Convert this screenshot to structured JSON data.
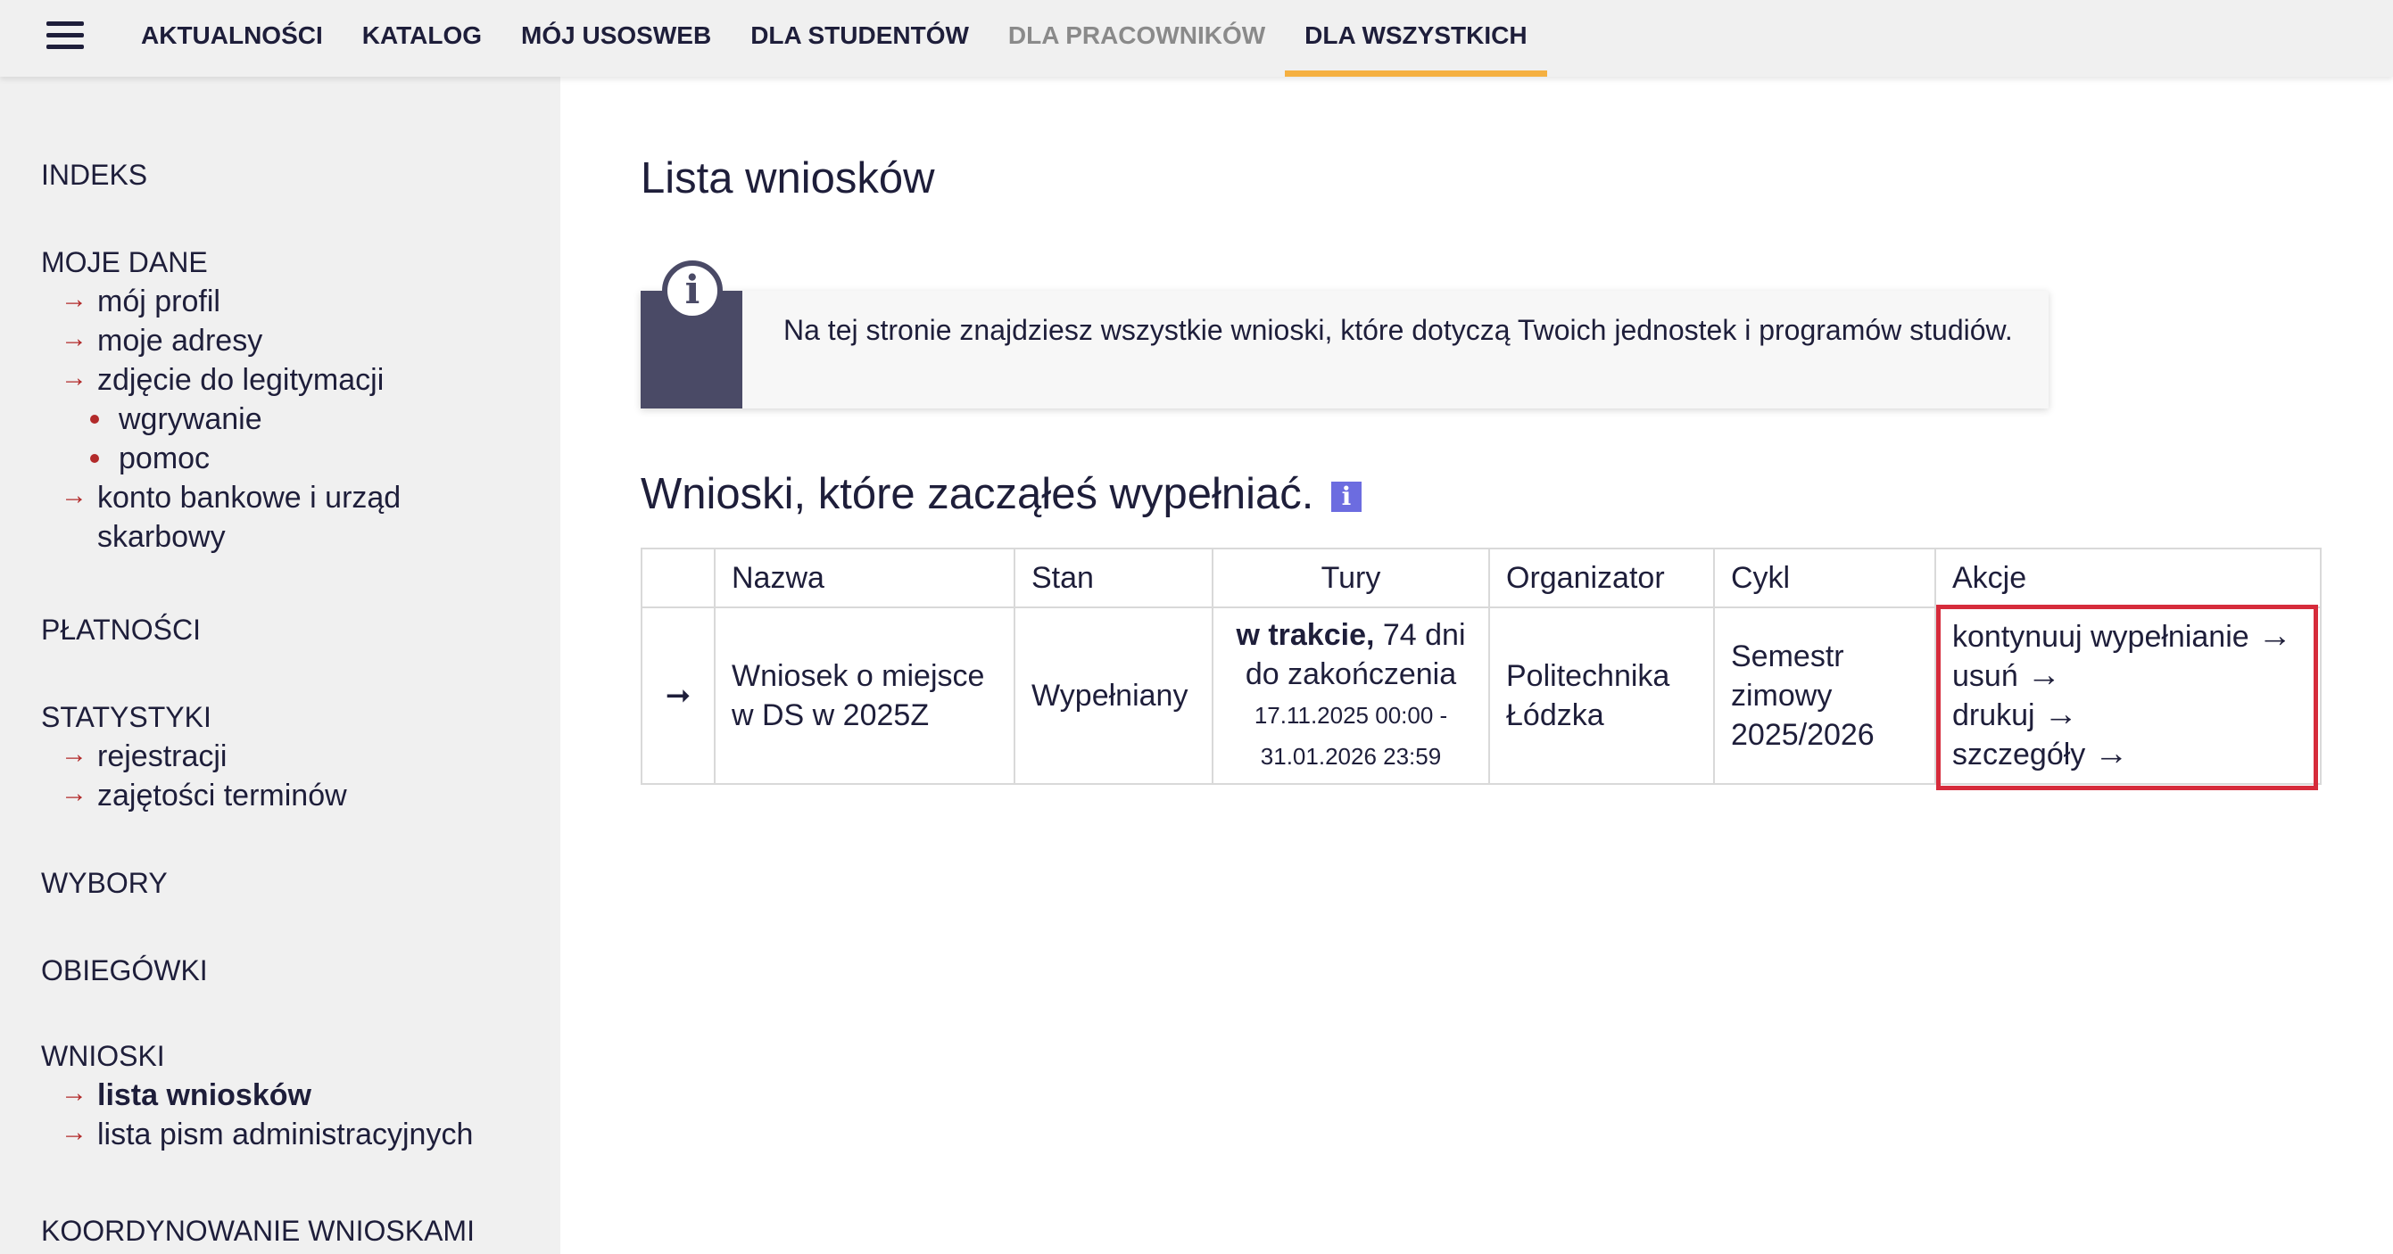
{
  "topnav": {
    "items": [
      {
        "label": "AKTUALNOŚCI"
      },
      {
        "label": "KATALOG"
      },
      {
        "label": "MÓJ USOSWEB"
      },
      {
        "label": "DLA STUDENTÓW"
      },
      {
        "label": "DLA PRACOWNIKÓW"
      },
      {
        "label": "DLA WSZYSTKICH"
      }
    ],
    "active": "DLA WSZYSTKICH",
    "accent_color": "#f5b041"
  },
  "sidebar": {
    "indeks": "INDEKS",
    "moje_dane": {
      "title": "MOJE DANE",
      "links": [
        "mój profil",
        "moje adresy",
        "zdjęcie do legitymacji",
        "konto bankowe i urząd skarbowy"
      ],
      "photo_sub": [
        "wgrywanie",
        "pomoc"
      ]
    },
    "platnosci": "PŁATNOŚCI",
    "statystyki": {
      "title": "STATYSTYKI",
      "links": [
        "rejestracji",
        "zajętości terminów"
      ]
    },
    "wybory": "WYBORY",
    "obiegowki": "OBIEGÓWKI",
    "wnioski": {
      "title": "WNIOSKI",
      "links": [
        "lista wniosków",
        "lista pism administracyjnych"
      ],
      "active": "lista wniosków"
    },
    "koordynowanie": "KOORDYNOWANIE WNIOSKAMI"
  },
  "main": {
    "page_title": "Lista wniosków",
    "info_text": "Na tej stronie znajdziesz wszystkie wnioski, które dotyczą Twoich jednostek i programów studiów.",
    "section_title": "Wnioski, które zacząłeś wypełniać.",
    "table": {
      "headers": [
        "",
        "Nazwa",
        "Stan",
        "Tury",
        "Organizator",
        "Cykl",
        "Akcje"
      ],
      "rows": [
        {
          "nazwa": "Wniosek o miejsce w DS w 2025Z",
          "stan": "Wypełniany",
          "tury_status": "w trakcie,",
          "tury_remaining": " 74 dni do zakończenia",
          "tury_dates": "17.11.2025 00:00 - 31.01.2026 23:59",
          "organizator": "Politechnika Łódzka",
          "cykl": "Semestr zimowy 2025/2026",
          "akcje": [
            "kontynuuj wypełnianie",
            "usuń",
            "drukuj",
            "szczegóły"
          ]
        }
      ]
    },
    "highlight_color": "#d62b3b"
  }
}
